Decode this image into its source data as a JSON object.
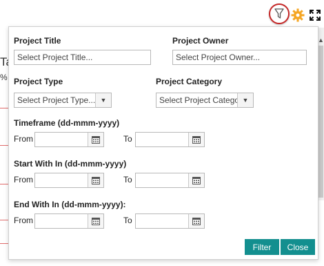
{
  "background": {
    "fragment_1": "Ta",
    "fragment_2": "%"
  },
  "toolbar": {
    "filter_icon": "filter-icon",
    "settings_icon": "gear-icon",
    "fullscreen_icon": "expand-icon",
    "accent_ring": "#c62828",
    "gear_color": "#f5a623"
  },
  "filter_panel": {
    "project_title": {
      "label": "Project Title",
      "placeholder": "Select Project Title..."
    },
    "project_owner": {
      "label": "Project Owner",
      "placeholder": "Select Project Owner..."
    },
    "project_type": {
      "label": "Project Type",
      "selected": "Select Project Type..."
    },
    "project_category": {
      "label": "Project Category",
      "selected": "Select Project Catego"
    },
    "timeframe": {
      "label": "Timeframe (dd-mmm-yyyy)",
      "from_label": "From",
      "to_label": "To"
    },
    "start_within": {
      "label": "Start With In (dd-mmm-yyyy)",
      "from_label": "From",
      "to_label": "To"
    },
    "end_within": {
      "label": "End With In (dd-mmm-yyyy):",
      "from_label": "From",
      "to_label": "To"
    },
    "filter_button": "Filter",
    "close_button": "Close",
    "button_color": "#138f8f"
  }
}
